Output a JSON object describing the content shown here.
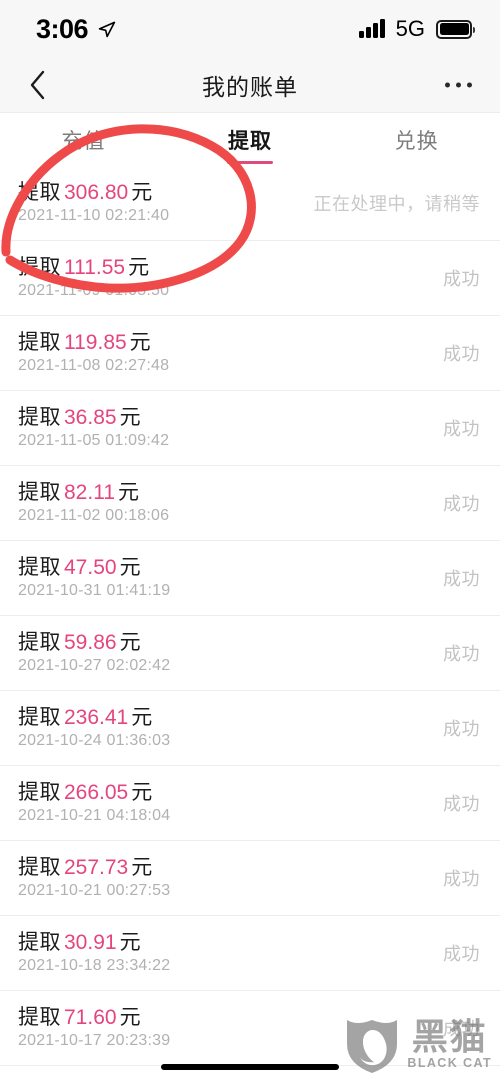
{
  "status_bar": {
    "time": "3:06",
    "location_icon": "location-arrow-icon",
    "signal_icon": "cellular-signal-icon",
    "network": "5G",
    "battery_icon": "battery-full-icon"
  },
  "nav": {
    "back_icon": "chevron-left-icon",
    "title": "我的账单",
    "more_icon": "ellipsis-icon"
  },
  "tabs": [
    {
      "label": "充值",
      "active": false
    },
    {
      "label": "提取",
      "active": true
    },
    {
      "label": "兑换",
      "active": false
    }
  ],
  "transactions": [
    {
      "type": "提取",
      "amount": "306.80",
      "unit": "元",
      "datetime": "2021-11-10 02:21:40",
      "status": "正在处理中，请稍等"
    },
    {
      "type": "提取",
      "amount": "111.55",
      "unit": "元",
      "datetime": "2021-11-09 01:05:50",
      "status": "成功"
    },
    {
      "type": "提取",
      "amount": "119.85",
      "unit": "元",
      "datetime": "2021-11-08 02:27:48",
      "status": "成功"
    },
    {
      "type": "提取",
      "amount": "36.85",
      "unit": "元",
      "datetime": "2021-11-05 01:09:42",
      "status": "成功"
    },
    {
      "type": "提取",
      "amount": "82.11",
      "unit": "元",
      "datetime": "2021-11-02 00:18:06",
      "status": "成功"
    },
    {
      "type": "提取",
      "amount": "47.50",
      "unit": "元",
      "datetime": "2021-10-31 01:41:19",
      "status": "成功"
    },
    {
      "type": "提取",
      "amount": "59.86",
      "unit": "元",
      "datetime": "2021-10-27 02:02:42",
      "status": "成功"
    },
    {
      "type": "提取",
      "amount": "236.41",
      "unit": "元",
      "datetime": "2021-10-24 01:36:03",
      "status": "成功"
    },
    {
      "type": "提取",
      "amount": "266.05",
      "unit": "元",
      "datetime": "2021-10-21 04:18:04",
      "status": "成功"
    },
    {
      "type": "提取",
      "amount": "257.73",
      "unit": "元",
      "datetime": "2021-10-21 00:27:53",
      "status": "成功"
    },
    {
      "type": "提取",
      "amount": "30.91",
      "unit": "元",
      "datetime": "2021-10-18 23:34:22",
      "status": "成功"
    },
    {
      "type": "提取",
      "amount": "71.60",
      "unit": "元",
      "datetime": "2021-10-17 20:23:39",
      "status": "成功"
    }
  ],
  "annotation": {
    "shape": "hand-drawn-red-circle",
    "color": "#ef4a4a"
  },
  "watermark": {
    "logo_icon": "black-cat-shield-logo-icon",
    "name_cn": "黑猫",
    "name_en": "BLACK CAT",
    "color": "#6e6e6e"
  },
  "theme": {
    "accent_pink": "#e4457e",
    "annotation_red": "#ef4a4a",
    "status_gray": "#c3c3c3",
    "date_gray": "#b1b1b1",
    "header_bg": "#f7f7f7"
  }
}
